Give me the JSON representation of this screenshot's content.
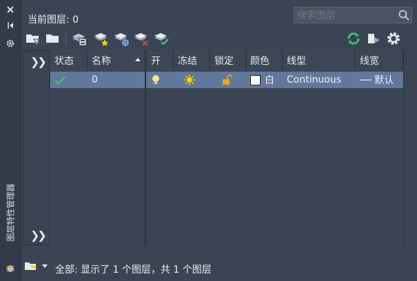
{
  "panel": {
    "title": "图层特性管理器"
  },
  "header": {
    "current_layer": "当前图层: 0",
    "search_placeholder": "搜索图层"
  },
  "columns": [
    "状态",
    "名称",
    "开",
    "冻结",
    "锁定",
    "颜色",
    "线型",
    "线宽"
  ],
  "rows": [
    {
      "status": "✔",
      "name": "0",
      "color_name": "白",
      "linetype": "Continuous",
      "lineweight": "── 默认"
    }
  ],
  "footer": {
    "status_text": "全部: 显示了 1 个图层，共 1 个图层"
  },
  "colors": {
    "accent_check": "#3fbf6a",
    "bulb": "#ffe28a",
    "sun": "#ffd200",
    "lock": "#e8a42c",
    "refresh": "#34c47c",
    "selected_row": "#607899"
  }
}
